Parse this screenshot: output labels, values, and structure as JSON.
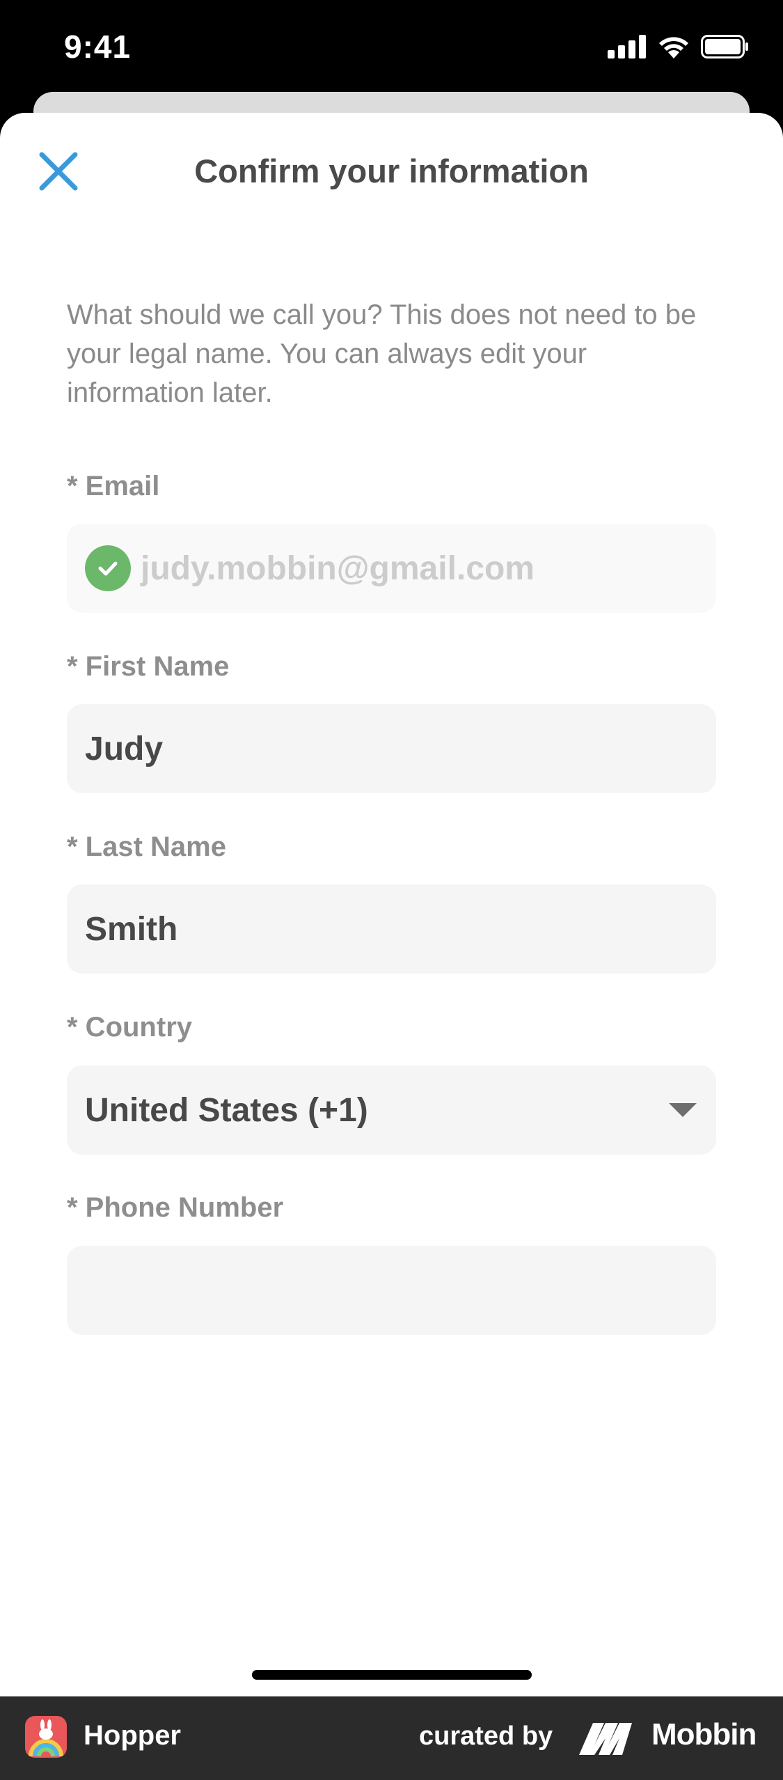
{
  "status_bar": {
    "time": "9:41"
  },
  "header": {
    "title": "Confirm your information"
  },
  "intro_text": "What should we call you? This does not need to be your legal name. You can always edit your information later.",
  "form": {
    "email": {
      "label": "* Email",
      "value": "judy.mobbin@gmail.com",
      "verified": true
    },
    "first_name": {
      "label": "* First Name",
      "value": "Judy"
    },
    "last_name": {
      "label": "* Last Name",
      "value": "Smith"
    },
    "country": {
      "label": "* Country",
      "value": "United States (+1)"
    },
    "phone": {
      "label": "* Phone Number",
      "value": ""
    }
  },
  "footer": {
    "app_name": "Hopper",
    "curated_by": "curated by",
    "brand": "Mobbin"
  },
  "colors": {
    "accent_close": "#3a9ad9",
    "verified_green": "#6cb86a",
    "footer_bg": "#2b2b2b"
  },
  "icons": [
    "close-icon",
    "check-icon",
    "dropdown-arrow-icon",
    "signal-icon",
    "wifi-icon",
    "battery-icon",
    "hopper-app-icon",
    "mobbin-logo-icon"
  ]
}
